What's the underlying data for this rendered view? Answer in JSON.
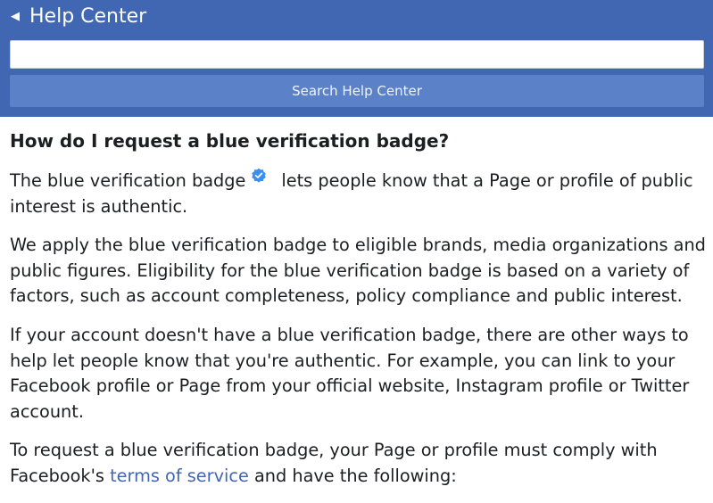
{
  "header": {
    "back_icon": "back-arrow-icon",
    "title": "Help Center",
    "search_placeholder": "",
    "search_value": "",
    "search_button_label": "Search Help Center"
  },
  "colors": {
    "header_bg": "#4267b2",
    "button_bg": "#5b82c8",
    "link": "#4267b2",
    "badge": "#3b8ff0"
  },
  "article": {
    "title": "How do I request a blue verification badge?",
    "p1_before": "The blue verification badge",
    "p1_icon": "verified-badge-icon",
    "p1_after": "lets people know that a Page or profile of public interest is authentic.",
    "p2": "We apply the blue verification badge to eligible brands, media organizations and public figures. Eligibility for the blue verification badge is based on a variety of factors, such as account completeness, policy compliance and public interest.",
    "p3": "If your account doesn't have a blue verification badge, there are other ways to help let people know that you're authentic. For example, you can link to your Facebook profile or Page from your official website, Instagram profile or Twitter account.",
    "p4_before": "To request a blue verification badge, your Page or profile must comply with Facebook's ",
    "p4_link": "terms of service",
    "p4_after": " and have the following:"
  }
}
